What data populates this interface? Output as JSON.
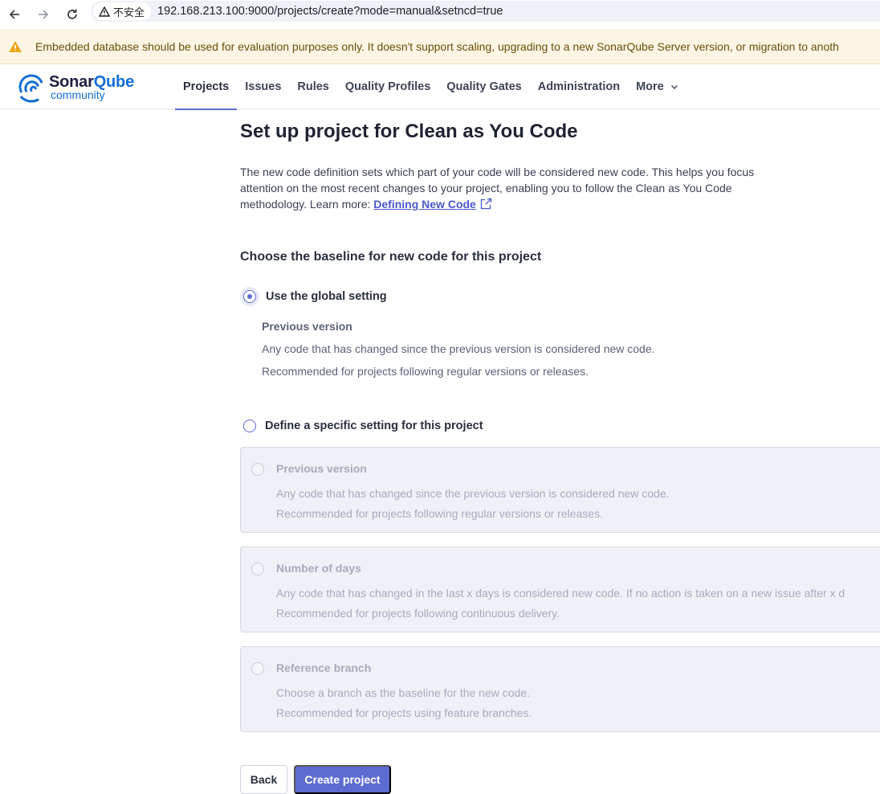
{
  "browser": {
    "security_label": "不安全",
    "url": "192.168.213.100:9000/projects/create?mode=manual&setncd=true"
  },
  "banner": {
    "text": "Embedded database should be used for evaluation purposes only. It doesn't support scaling, upgrading to a new SonarQube Server version, or migration to anoth"
  },
  "logo": {
    "word_a": "Sonar",
    "word_b": "Qube",
    "sub": "community"
  },
  "nav": {
    "items": [
      "Projects",
      "Issues",
      "Rules",
      "Quality Profiles",
      "Quality Gates",
      "Administration",
      "More"
    ],
    "active": "Projects"
  },
  "page": {
    "title": "Set up project for Clean as You Code",
    "intro": "The new code definition sets which part of your code will be considered new code. This helps you focus attention on the most recent changes to your project, enabling you to follow the Clean as You Code methodology. Learn more: ",
    "intro_link": "Defining New Code",
    "section_title": "Choose the baseline for new code for this project"
  },
  "global_option": {
    "label": "Use the global setting",
    "selected": true,
    "name": "Previous version",
    "line1": "Any code that has changed since the previous version is considered new code.",
    "line2": "Recommended for projects following regular versions or releases."
  },
  "specific_option": {
    "label": "Define a specific setting for this project",
    "selected": false,
    "cards": [
      {
        "name": "Previous version",
        "line1": "Any code that has changed since the previous version is considered new code.",
        "line2": "Recommended for projects following regular versions or releases."
      },
      {
        "name": "Number of days",
        "line1": "Any code that has changed in the last x days is considered new code. If no action is taken on a new issue after x d",
        "line2": "Recommended for projects following continuous delivery."
      },
      {
        "name": "Reference branch",
        "line1": "Choose a branch as the baseline for the new code.",
        "line2": "Recommended for projects using feature branches."
      }
    ]
  },
  "buttons": {
    "back": "Back",
    "create": "Create project"
  },
  "colors": {
    "accent": "#5d6cd0",
    "banner_bg": "#fdf5e3",
    "warning": "#e9a61a",
    "brand_blue": "#126ed3"
  }
}
